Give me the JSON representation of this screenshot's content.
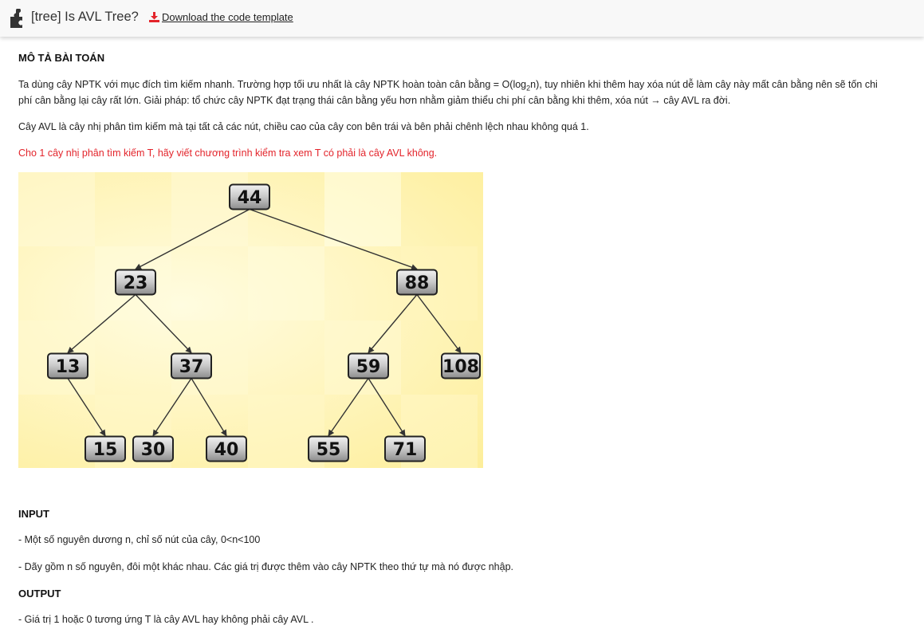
{
  "header": {
    "title": "[tree] Is AVL Tree?",
    "download_label": "Download the code template",
    "icons": {
      "app": "puzzle-icon",
      "download": "download-icon"
    },
    "colors": {
      "download_icon": "#e3242b"
    }
  },
  "description": {
    "heading": "MÔ TẢ BÀI TOÁN",
    "para1_line1_a": "Ta dùng cây NPTK với mục đích tìm kiếm nhanh. Trường hợp tối ưu nhất là cây NPTK hoàn toàn cân bằng = O(log",
    "para1_sub": "2",
    "para1_line1_b": "n), tuy nhiên khi thêm hay xóa nút dễ làm cây này mất cân bằng nên sẽ tốn chi",
    "para1_line2": "phí cân bằng lại cây rất lớn. Giải pháp: tổ chức cây NPTK đạt trạng thái cân bằng yếu hơn nhằm giảm thiểu chi phí cân bằng khi thêm, xóa nút → cây AVL ra đời.",
    "para2": "Cây AVL là cây nhị phân tìm kiếm mà tại tất cả các nút, chiều cao của cây con bên trái và bên phải chênh lệch nhau không quá 1.",
    "para3": "Cho 1 cây nhị phân tìm kiếm T, hãy viết chương trình kiểm tra xem T có phải là cây AVL không.",
    "para3_color": "#e3242b"
  },
  "tree": {
    "nodes": [
      {
        "id": "n44",
        "label": "44"
      },
      {
        "id": "n23",
        "label": "23"
      },
      {
        "id": "n88",
        "label": "88"
      },
      {
        "id": "n13",
        "label": "13"
      },
      {
        "id": "n37",
        "label": "37"
      },
      {
        "id": "n59",
        "label": "59"
      },
      {
        "id": "n108",
        "label": "108"
      },
      {
        "id": "n15",
        "label": "15"
      },
      {
        "id": "n30",
        "label": "30"
      },
      {
        "id": "n40",
        "label": "40"
      },
      {
        "id": "n55",
        "label": "55"
      },
      {
        "id": "n71",
        "label": "71"
      }
    ],
    "edges": [
      [
        "n44",
        "n23"
      ],
      [
        "n44",
        "n88"
      ],
      [
        "n23",
        "n13"
      ],
      [
        "n23",
        "n37"
      ],
      [
        "n88",
        "n59"
      ],
      [
        "n88",
        "n108"
      ],
      [
        "n13",
        "n15"
      ],
      [
        "n37",
        "n30"
      ],
      [
        "n37",
        "n40"
      ],
      [
        "n59",
        "n55"
      ],
      [
        "n59",
        "n71"
      ]
    ]
  },
  "input": {
    "heading": "INPUT",
    "line1": "- Một số nguyên dương n, chỉ số nút của cây, 0<n<100",
    "line2": "- Dãy gồm n số nguyên, đôi một khác nhau. Các giá trị được thêm vào cây NPTK theo thứ tự mà nó được nhập."
  },
  "output": {
    "heading": "OUTPUT",
    "line1": "- Giá trị 1 hoặc 0 tương ứng T là cây AVL hay không phải cây AVL ."
  }
}
